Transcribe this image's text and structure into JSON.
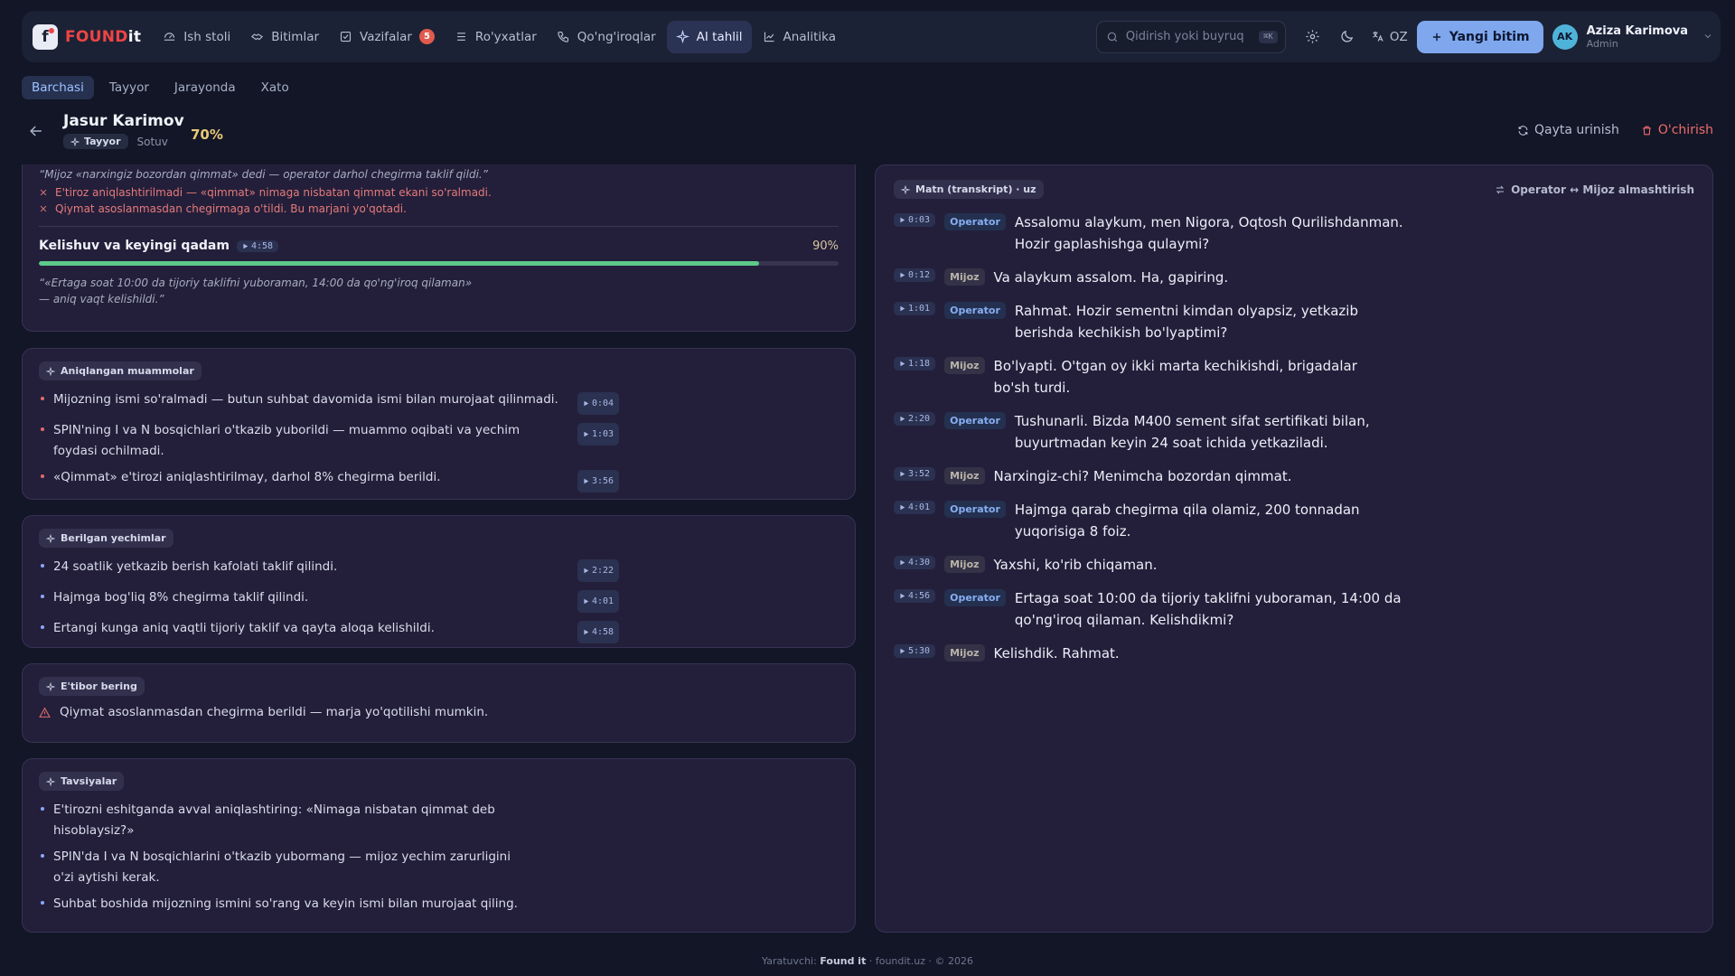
{
  "app": {
    "logo_found": "FOUND",
    "logo_it": "it"
  },
  "nav": {
    "items": [
      {
        "label": "Ish stoli",
        "icon": "dashboard-icon"
      },
      {
        "label": "Bitimlar",
        "icon": "handshake-icon"
      },
      {
        "label": "Vazifalar",
        "icon": "checkbox-icon",
        "badge": "5"
      },
      {
        "label": "Ro'yxatlar",
        "icon": "list-icon"
      },
      {
        "label": "Qo'ng'iroqlar",
        "icon": "phone-icon"
      },
      {
        "label": "AI tahlil",
        "icon": "sparkle-icon",
        "active": true
      },
      {
        "label": "Analitika",
        "icon": "chart-icon"
      }
    ],
    "search_placeholder": "Qidirish yoki buyruq",
    "search_shortcut": "⌘K",
    "lang": "OZ",
    "new_button": "Yangi bitim",
    "user": {
      "initials": "AK",
      "name": "Aziza Karimova",
      "role": "Admin"
    }
  },
  "filters": {
    "tabs": [
      "Barchasi",
      "Tayyor",
      "Jarayonda",
      "Xato"
    ],
    "active": "Barchasi"
  },
  "detail": {
    "name": "Jasur Karimov",
    "status": "Tayyor",
    "department": "Sotuv",
    "score": "70%",
    "retry": "Qayta urinish",
    "delete": "O'chirish"
  },
  "stage_card": {
    "prev_quote": "“Mijoz «narxingiz bozordan qimmat» dedi — operator darhol chegirma taklif qildi.”",
    "errors": [
      "E'tiroz aniqlashtirilmadi — «qimmat» nimaga nisbatan qimmat ekani so'ralmadi.",
      "Qiymat asoslanmasdan chegirmaga o'tildi. Bu marjani yo'qotadi."
    ],
    "step_title": "Kelishuv va keyingi qadam",
    "step_ts": "4:58",
    "step_pct": "90%",
    "step_value": 0.9,
    "step_quote": "“«Ertaga soat 10:00 da tijoriy taklifni yuboraman, 14:00 da qo'ng'iroq qilaman» — aniq vaqt kelishildi.”"
  },
  "problems": {
    "label": "Aniqlangan muammolar",
    "items": [
      {
        "text": "Mijozning ismi so'ralmadi — butun suhbat davomida ismi bilan murojaat qilinmadi.",
        "ts": "0:04"
      },
      {
        "text": "SPIN'ning I va N bosqichlari o'tkazib yuborildi — muammo oqibati va yechim foydasi ochilmadi.",
        "ts": "1:03"
      },
      {
        "text": "«Qimmat» e'tirozi aniqlashtirilmay, darhol 8% chegirma berildi.",
        "ts": "3:56"
      }
    ]
  },
  "solutions": {
    "label": "Berilgan yechimlar",
    "items": [
      {
        "text": "24 soatlik yetkazib berish kafolati taklif qilindi.",
        "ts": "2:22"
      },
      {
        "text": "Hajmga bog'liq 8% chegirma taklif qilindi.",
        "ts": "4:01"
      },
      {
        "text": "Ertangi kunga aniq vaqtli tijoriy taklif va qayta aloqa kelishildi.",
        "ts": "4:58"
      }
    ]
  },
  "attention": {
    "label": "E'tibor bering",
    "text": "Qiymat asoslanmasdan chegirma berildi — marja yo'qotilishi mumkin."
  },
  "recommendations": {
    "label": "Tavsiyalar",
    "items": [
      "E'tirozni eshitganda avval aniqlashtiring: «Nimaga nisbatan qimmat deb hisoblaysiz?»",
      "SPIN'da I va N bosqichlarini o'tkazib yubormang — mijoz yechim zarurligini o'zi aytishi kerak.",
      "Suhbat boshida mijozning ismini so'rang va keyin ismi bilan murojaat qiling."
    ]
  },
  "transcript": {
    "label": "Matn (transkript) · uz",
    "swap": "Operator ↔ Mijoz almashtirish",
    "lines": [
      {
        "ts": "0:03",
        "role": "Operator",
        "text": "Assalomu alaykum, men Nigora, Oqtosh Qurilishdanman. Hozir gaplashishga qulaymi?"
      },
      {
        "ts": "0:12",
        "role": "Mijoz",
        "text": "Va alaykum assalom. Ha, gapiring."
      },
      {
        "ts": "1:01",
        "role": "Operator",
        "text": "Rahmat. Hozir sementni kimdan olyapsiz, yetkazib berishda kechikish bo'lyaptimi?"
      },
      {
        "ts": "1:18",
        "role": "Mijoz",
        "text": "Bo'lyapti. O'tgan oy ikki marta kechikishdi, brigadalar bo'sh turdi."
      },
      {
        "ts": "2:20",
        "role": "Operator",
        "text": "Tushunarli. Bizda M400 sement sifat sertifikati bilan, buyurtmadan keyin 24 soat ichida yetkaziladi."
      },
      {
        "ts": "3:52",
        "role": "Mijoz",
        "text": "Narxingiz-chi? Menimcha bozordan qimmat."
      },
      {
        "ts": "4:01",
        "role": "Operator",
        "text": "Hajmga qarab chegirma qila olamiz, 200 tonnadan yuqorisiga 8 foiz."
      },
      {
        "ts": "4:30",
        "role": "Mijoz",
        "text": "Yaxshi, ko'rib chiqaman."
      },
      {
        "ts": "4:56",
        "role": "Operator",
        "text": "Ertaga soat 10:00 da tijoriy taklifni yuboraman, 14:00 da qo'ng'iroq qilaman. Kelishdikmi?"
      },
      {
        "ts": "5:30",
        "role": "Mijoz",
        "text": "Kelishdik. Rahmat."
      }
    ]
  },
  "footer": {
    "prefix": "Yaratuvchi:",
    "brand": "Found it",
    "sep1": "·",
    "site": "foundit.uz",
    "sep2": "·",
    "copy": "© 2026"
  }
}
